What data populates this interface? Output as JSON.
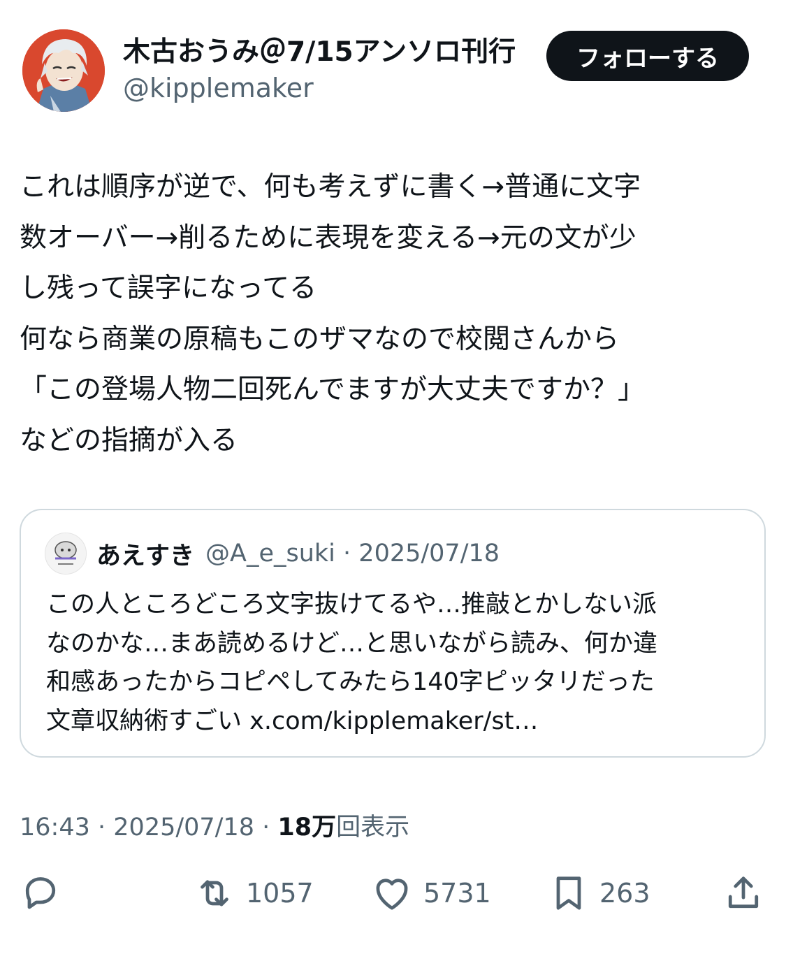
{
  "author": {
    "display_name": "木古おうみ＠7/15アンソロ刊行",
    "handle": "@kipplemaker"
  },
  "follow_button_label": "フォローする",
  "tweet": {
    "lines": [
      "これは順序が逆で、何も考えずに書く→普通に文字",
      "数オーバー→削るために表現を変える→元の文が少",
      "し残って誤字になってる",
      "何なら商業の原稿もこのザマなので校閲さんから",
      "「この登場人物二回死んでますが大丈夫ですか？」",
      "などの指摘が入る"
    ]
  },
  "quoted_tweet": {
    "display_name": "あえすき",
    "handle": "@A_e_suki",
    "date": "2025/07/18",
    "lines": [
      "この人ところどころ文字抜けてるや…推敲とかしない派",
      "なのかな…まあ読めるけど…と思いながら読み、何か違",
      "和感あったからコピペしてみたら140字ピッタリだった",
      "文章収納術すごい x.com/kipplemaker/st…"
    ]
  },
  "meta": {
    "time": "16:43",
    "date": "2025/07/18",
    "views_count": "18万",
    "views_label": "回表示"
  },
  "actions": {
    "reply": {
      "icon": "reply-icon"
    },
    "retweet": {
      "icon": "retweet-icon",
      "count": "1057"
    },
    "like": {
      "icon": "heart-icon",
      "count": "5731"
    },
    "bookmark": {
      "icon": "bookmark-icon",
      "count": "263"
    },
    "share": {
      "icon": "share-icon"
    }
  },
  "colors": {
    "text": "#0f1419",
    "secondary_text": "#536471",
    "border": "#cfd9de",
    "follow_button_bg": "#0f1419",
    "avatar_bg": "#d9482e"
  }
}
